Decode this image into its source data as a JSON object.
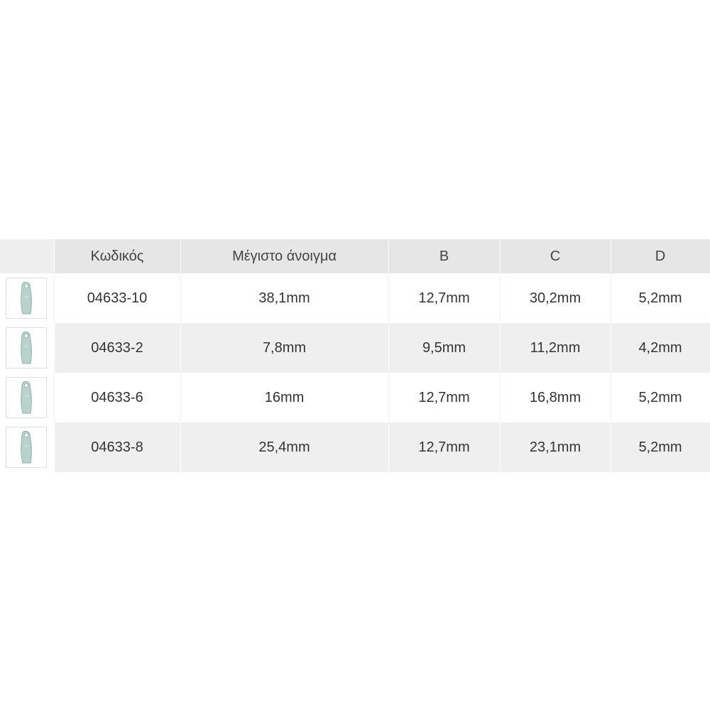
{
  "table": {
    "headers": {
      "image": "",
      "code": "Κωδικός",
      "max_opening": "Μέγιστο άνοιγμα",
      "b": "B",
      "c": "C",
      "d": "D"
    },
    "rows": [
      {
        "icon": "clamp-thumbnail-icon",
        "code": "04633-10",
        "max_opening": "38,1mm",
        "b": "12,7mm",
        "c": "30,2mm",
        "d": "5,2mm"
      },
      {
        "icon": "clamp-thumbnail-icon",
        "code": "04633-2",
        "max_opening": "7,8mm",
        "b": "9,5mm",
        "c": "11,2mm",
        "d": "4,2mm"
      },
      {
        "icon": "clamp-thumbnail-icon",
        "code": "04633-6",
        "max_opening": "16mm",
        "b": "12,7mm",
        "c": "16,8mm",
        "d": "5,2mm"
      },
      {
        "icon": "clamp-thumbnail-icon",
        "code": "04633-8",
        "max_opening": "25,4mm",
        "b": "12,7mm",
        "c": "23,1mm",
        "d": "5,2mm"
      }
    ]
  },
  "colors": {
    "header_bg": "#e6e6e6",
    "row_alt_bg": "#efefef",
    "text": "#333333",
    "clamp_color": "#a9c7bf"
  }
}
